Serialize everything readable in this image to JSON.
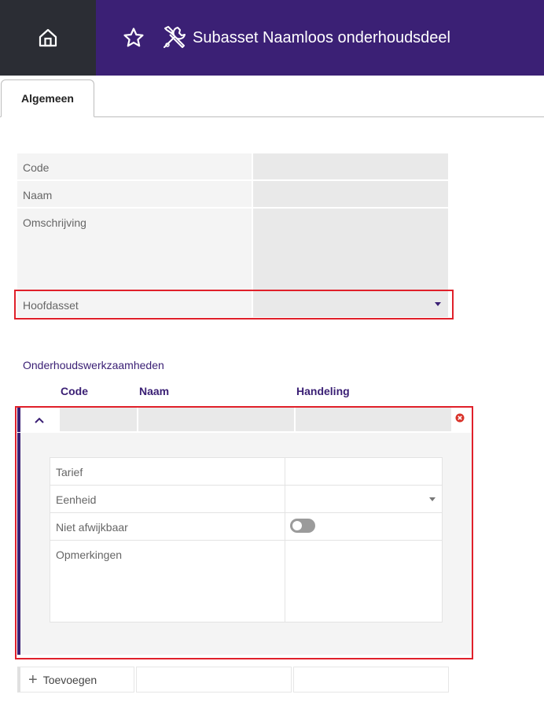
{
  "header": {
    "title": "Subasset Naamloos onderhoudsdeel",
    "icons": {
      "home": "home-icon",
      "favorite": "star-icon",
      "type": "tools-icon"
    },
    "colors": {
      "home_bg": "#2b2d34",
      "title_bg": "#3b2075"
    }
  },
  "tabs": [
    {
      "label": "Algemeen",
      "active": true
    }
  ],
  "form": {
    "code_label": "Code",
    "code_value": "",
    "naam_label": "Naam",
    "naam_value": "",
    "omschrijving_label": "Omschrijving",
    "omschrijving_value": "",
    "hoofdasset_label": "Hoofdasset",
    "hoofdasset_value": ""
  },
  "work": {
    "title": "Onderhoudswerkzaamheden",
    "columns": [
      "Code",
      "Naam",
      "Handeling"
    ],
    "rows": [
      {
        "code": "",
        "naam": "",
        "handeling": "",
        "expanded": true,
        "details": {
          "tarief_label": "Tarief",
          "tarief_value": "",
          "eenheid_label": "Eenheid",
          "eenheid_value": "",
          "niet_afwijkbaar_label": "Niet afwijkbaar",
          "niet_afwijkbaar_value": false,
          "opmerkingen_label": "Opmerkingen",
          "opmerkingen_value": ""
        }
      }
    ],
    "add_label": "Toevoegen"
  }
}
